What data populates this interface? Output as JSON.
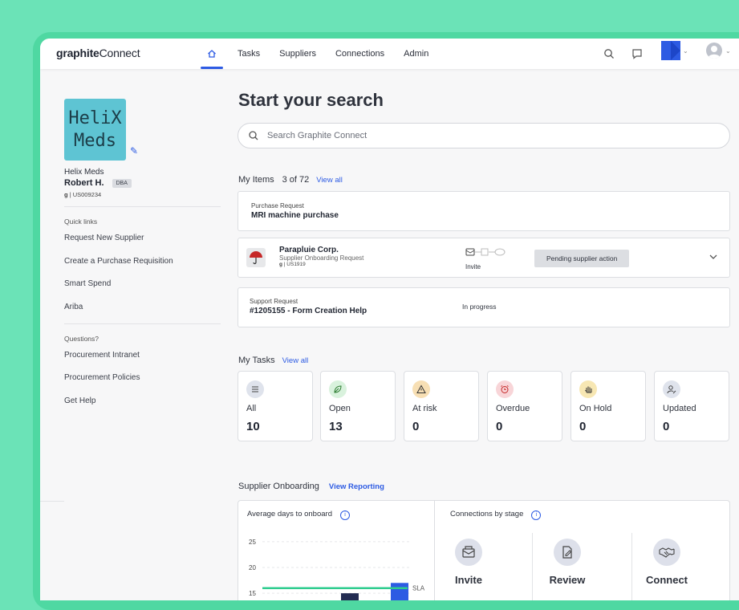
{
  "app": {
    "logo_left": "graphite",
    "logo_right": "Connect",
    "nav": [
      "Tasks",
      "Suppliers",
      "Connections",
      "Admin"
    ]
  },
  "sidebar": {
    "logo_text_line1": "HeliX",
    "logo_text_line2": "Meds",
    "company_name": "Helix Meds",
    "user_name": "Robert H.",
    "dba_badge": "DBA",
    "user_id_prefix": "g",
    "user_id": "| US009234",
    "quick_links_label": "Quick links",
    "quick_links": [
      "Request New Supplier",
      "Create a Purchase Requisition",
      "Smart Spend",
      "Ariba"
    ],
    "questions_label": "Questions?",
    "question_links": [
      "Procurement Intranet",
      "Procurement Policies",
      "Get Help"
    ]
  },
  "main": {
    "heading": "Start your search",
    "search_placeholder": "Search Graphite Connect",
    "my_items": {
      "label": "My Items",
      "count": "3 of 72",
      "view_all": "View all",
      "items": [
        {
          "type": "Purchase Request",
          "title": "MRI machine purchase"
        },
        {
          "company": "Parapluie Corp.",
          "type": "Supplier Onboarding Request",
          "id_prefix": "g",
          "id": "| US1919",
          "step": "Invite",
          "status": "Pending supplier action"
        },
        {
          "type": "Support Request",
          "title": "#1205155 - Form Creation Help",
          "status": "In progress"
        }
      ]
    },
    "my_tasks": {
      "label": "My Tasks",
      "view_all": "View all",
      "tasks": [
        {
          "label": "All",
          "count": "10",
          "color": "#dfe3ec"
        },
        {
          "label": "Open",
          "count": "13",
          "color": "#d9f2dd"
        },
        {
          "label": "At risk",
          "count": "0",
          "color": "#f7dfb4"
        },
        {
          "label": "Overdue",
          "count": "0",
          "color": "#f8d5d8"
        },
        {
          "label": "On Hold",
          "count": "0",
          "color": "#f7e7b3"
        },
        {
          "label": "Updated",
          "count": "0",
          "color": "#dfe3ec"
        }
      ]
    },
    "onboarding": {
      "label": "Supplier Onboarding",
      "view_reporting": "View Reporting",
      "avg_days_label": "Average days to onboard",
      "connections_label": "Connections by stage",
      "stages": [
        "Invite",
        "Review",
        "Connect"
      ]
    }
  },
  "chart_data": {
    "type": "bar",
    "title": "Average days to onboard",
    "y_ticks": [
      "25",
      "20",
      "15"
    ],
    "ylim": [
      13,
      27
    ],
    "series": [
      {
        "values": [
          15,
          17
        ]
      }
    ],
    "reference_line": {
      "label": "SLA",
      "value": 16
    }
  }
}
